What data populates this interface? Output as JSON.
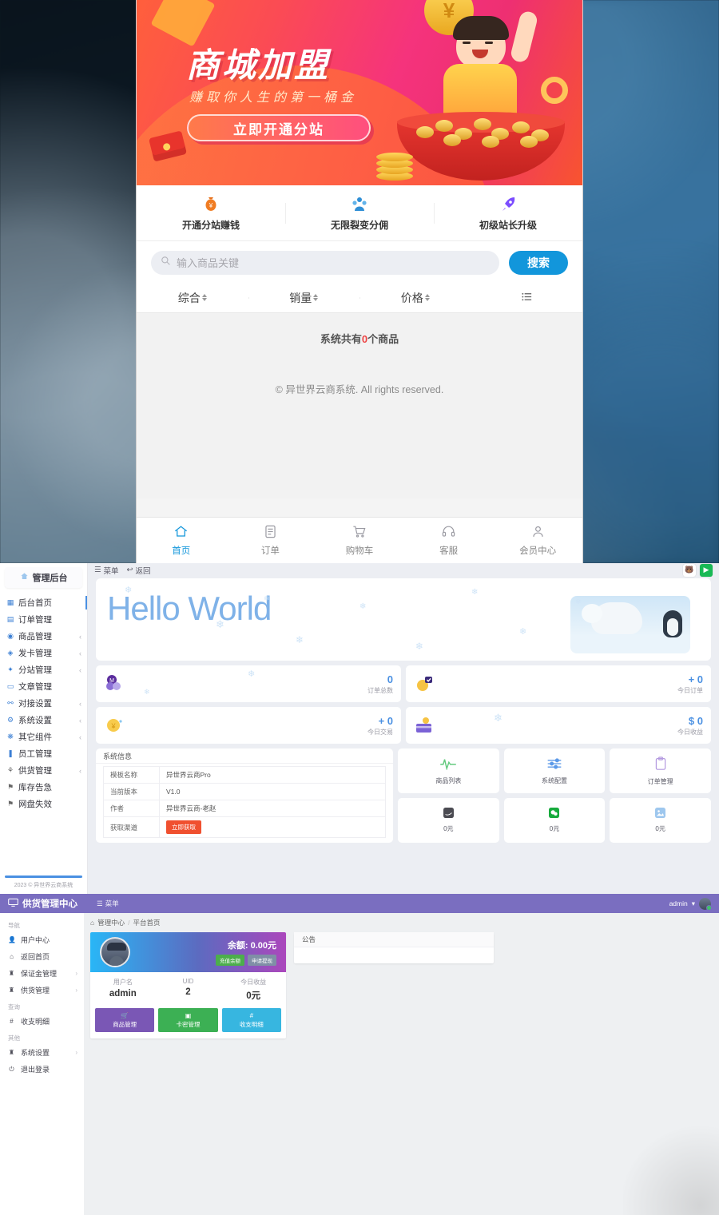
{
  "storefront": {
    "banner": {
      "title": "商城加盟",
      "subtitle": "赚取你人生的第一桶金",
      "cta": "立即开通分站"
    },
    "features": [
      {
        "icon": "money-bag-icon",
        "label": "开通分站赚钱"
      },
      {
        "icon": "users-group-icon",
        "label": "无限裂变分佣"
      },
      {
        "icon": "rocket-icon",
        "label": "初级站长升级"
      }
    ],
    "search": {
      "placeholder": "输入商品关键",
      "value": "",
      "button": "搜索"
    },
    "sorts": [
      "综合",
      "销量",
      "价格"
    ],
    "goods": {
      "prefix": "系统共有",
      "count": "0",
      "suffix": "个商品"
    },
    "copyright": "© 异世界云商系统. All rights reserved.",
    "tabs": [
      {
        "icon": "home-icon",
        "label": "首页",
        "active": true
      },
      {
        "icon": "order-list-icon",
        "label": "订单",
        "active": false
      },
      {
        "icon": "cart-icon",
        "label": "购物车",
        "active": false
      },
      {
        "icon": "headset-icon",
        "label": "客服",
        "active": false
      },
      {
        "icon": "user-icon",
        "label": "会员中心",
        "active": false
      }
    ]
  },
  "admin": {
    "logo": "管理后台",
    "menu": [
      {
        "label": "后台首页",
        "icon": "dashboard-icon",
        "arrow": "",
        "active": true
      },
      {
        "label": "订单管理",
        "icon": "order-icon",
        "arrow": ""
      },
      {
        "label": "商品管理",
        "icon": "goods-icon",
        "arrow": "‹"
      },
      {
        "label": "发卡管理",
        "icon": "card-icon",
        "arrow": "‹"
      },
      {
        "label": "分站管理",
        "icon": "site-icon",
        "arrow": "‹"
      },
      {
        "label": "文章管理",
        "icon": "article-icon",
        "arrow": ""
      },
      {
        "label": "对接设置",
        "icon": "plug-icon",
        "arrow": "‹"
      },
      {
        "label": "系统设置",
        "icon": "settings-icon",
        "arrow": "‹"
      },
      {
        "label": "其它组件",
        "icon": "component-icon",
        "arrow": "‹"
      },
      {
        "label": "员工管理",
        "icon": "staff-icon",
        "arrow": ""
      },
      {
        "label": "供货管理",
        "icon": "supply-icon",
        "arrow": "‹"
      },
      {
        "label": "库存告急",
        "icon": "alert-icon",
        "arrow": ""
      },
      {
        "label": "网盘失效",
        "icon": "cloud-fail-icon",
        "arrow": ""
      }
    ],
    "side_copyright": "2023 © 异世界云商系统",
    "topbar": {
      "menu": "菜单",
      "back": "返回"
    },
    "hello": "Hello World",
    "stats": [
      {
        "value": "0",
        "label": "订单总数",
        "icon": "coins-purple-icon"
      },
      {
        "value": "+ 0",
        "label": "今日订单",
        "icon": "coin-check-icon"
      },
      {
        "value": "+ 0",
        "label": "今日交易",
        "icon": "coin-yellow-icon"
      },
      {
        "value": "$ 0",
        "label": "今日收益",
        "icon": "credit-card-icon"
      }
    ],
    "sysinfo": {
      "title": "系统信息",
      "rows": [
        {
          "key": "模板名称",
          "value": "异世界云商Pro"
        },
        {
          "key": "当前版本",
          "value": "V1.0"
        },
        {
          "key": "作者",
          "value": "异世界云商-老赵"
        },
        {
          "key": "获取渠道",
          "value": "立即获取",
          "is_button": true
        }
      ]
    },
    "tiles": [
      {
        "label": "商品列表",
        "icon": "pulse-icon"
      },
      {
        "label": "系统配置",
        "icon": "sliders-icon"
      },
      {
        "label": "订单管理",
        "icon": "clipboard-icon"
      },
      {
        "label": "0元",
        "icon": "alipay-icon"
      },
      {
        "label": "0元",
        "icon": "wechat-pay-icon"
      },
      {
        "label": "0元",
        "icon": "other-pay-icon"
      }
    ]
  },
  "supplier": {
    "title": "供货管理中心",
    "menu_btn": "菜单",
    "user": "admin",
    "breadcrumb": [
      "管理中心",
      "平台首页"
    ],
    "sidebar": [
      {
        "group": "导航",
        "items": [
          {
            "label": "用户中心",
            "icon": "user-icon",
            "arrow": ""
          },
          {
            "label": "返回首页",
            "icon": "home-icon",
            "arrow": ""
          },
          {
            "label": "保证金管理",
            "icon": "deposit-icon",
            "arrow": "›"
          },
          {
            "label": "供货管理",
            "icon": "supply-icon",
            "arrow": "›"
          }
        ]
      },
      {
        "group": "查询",
        "items": [
          {
            "label": "收支明细",
            "icon": "hash-icon",
            "arrow": ""
          }
        ]
      },
      {
        "group": "其他",
        "items": [
          {
            "label": "系统设置",
            "icon": "settings-icon",
            "arrow": "›"
          },
          {
            "label": "退出登录",
            "icon": "power-icon",
            "arrow": ""
          }
        ]
      }
    ],
    "card": {
      "balance_label": "余额:",
      "balance_value": "0.00元",
      "recharge": "充值余额",
      "withdraw": "申请提现",
      "stats": [
        {
          "label": "用户名",
          "value": "admin"
        },
        {
          "label": "UID",
          "value": "2"
        },
        {
          "label": "今日收益",
          "value": "0元"
        }
      ],
      "actions": [
        {
          "label": "商品管理",
          "icon": "cart-icon",
          "color": "#7a57b5"
        },
        {
          "label": "卡密管理",
          "icon": "card-icon",
          "color": "#3cb054"
        },
        {
          "label": "收支明细",
          "icon": "hash-icon",
          "color": "#37b6e0"
        }
      ]
    },
    "notice": {
      "title": "公告",
      "body": ""
    }
  },
  "colors": {
    "shop_accent": "#1296db",
    "banner_red": "#f5337c",
    "admin_accent": "#4a90e2",
    "supplier_purple": "#7a6ec0",
    "cta_orange": "#f0502f"
  }
}
